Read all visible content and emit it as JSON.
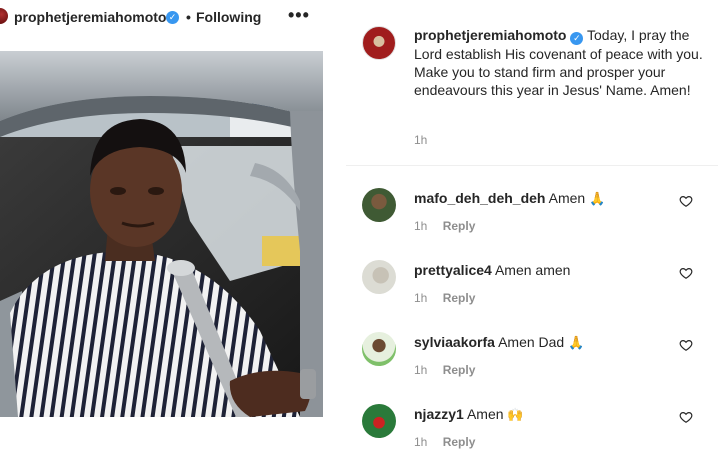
{
  "post": {
    "username": "prophetjeremiahomoto",
    "separator": "•",
    "follow_status": "Following",
    "more_label": "•••",
    "photo_alt": "Photo of a man in a striped shirt seated in a car"
  },
  "caption": {
    "username": "prophetjeremiahomoto",
    "text": "Today, I pray the Lord establish His covenant of peace with you. Make you to stand firm and prosper your endeavours this year in Jesus' Name. Amen!",
    "time": "1h"
  },
  "comments": [
    {
      "username": "mafo_deh_deh_deh",
      "text": "Amen",
      "emoji": "🙏",
      "time": "1h",
      "reply": "Reply"
    },
    {
      "username": "prettyalice4",
      "text": "Amen amen",
      "emoji": "",
      "time": "1h",
      "reply": "Reply"
    },
    {
      "username": "sylviaakorfa",
      "text": "Amen Dad",
      "emoji": "🙏",
      "time": "1h",
      "reply": "Reply"
    },
    {
      "username": "njazzy1",
      "text": "Amen",
      "emoji": "🙌",
      "time": "1h",
      "reply": "Reply"
    }
  ],
  "colors": {
    "verified": "#3897f0",
    "meta_text": "#8e8e8e",
    "primary_text": "#262626"
  }
}
